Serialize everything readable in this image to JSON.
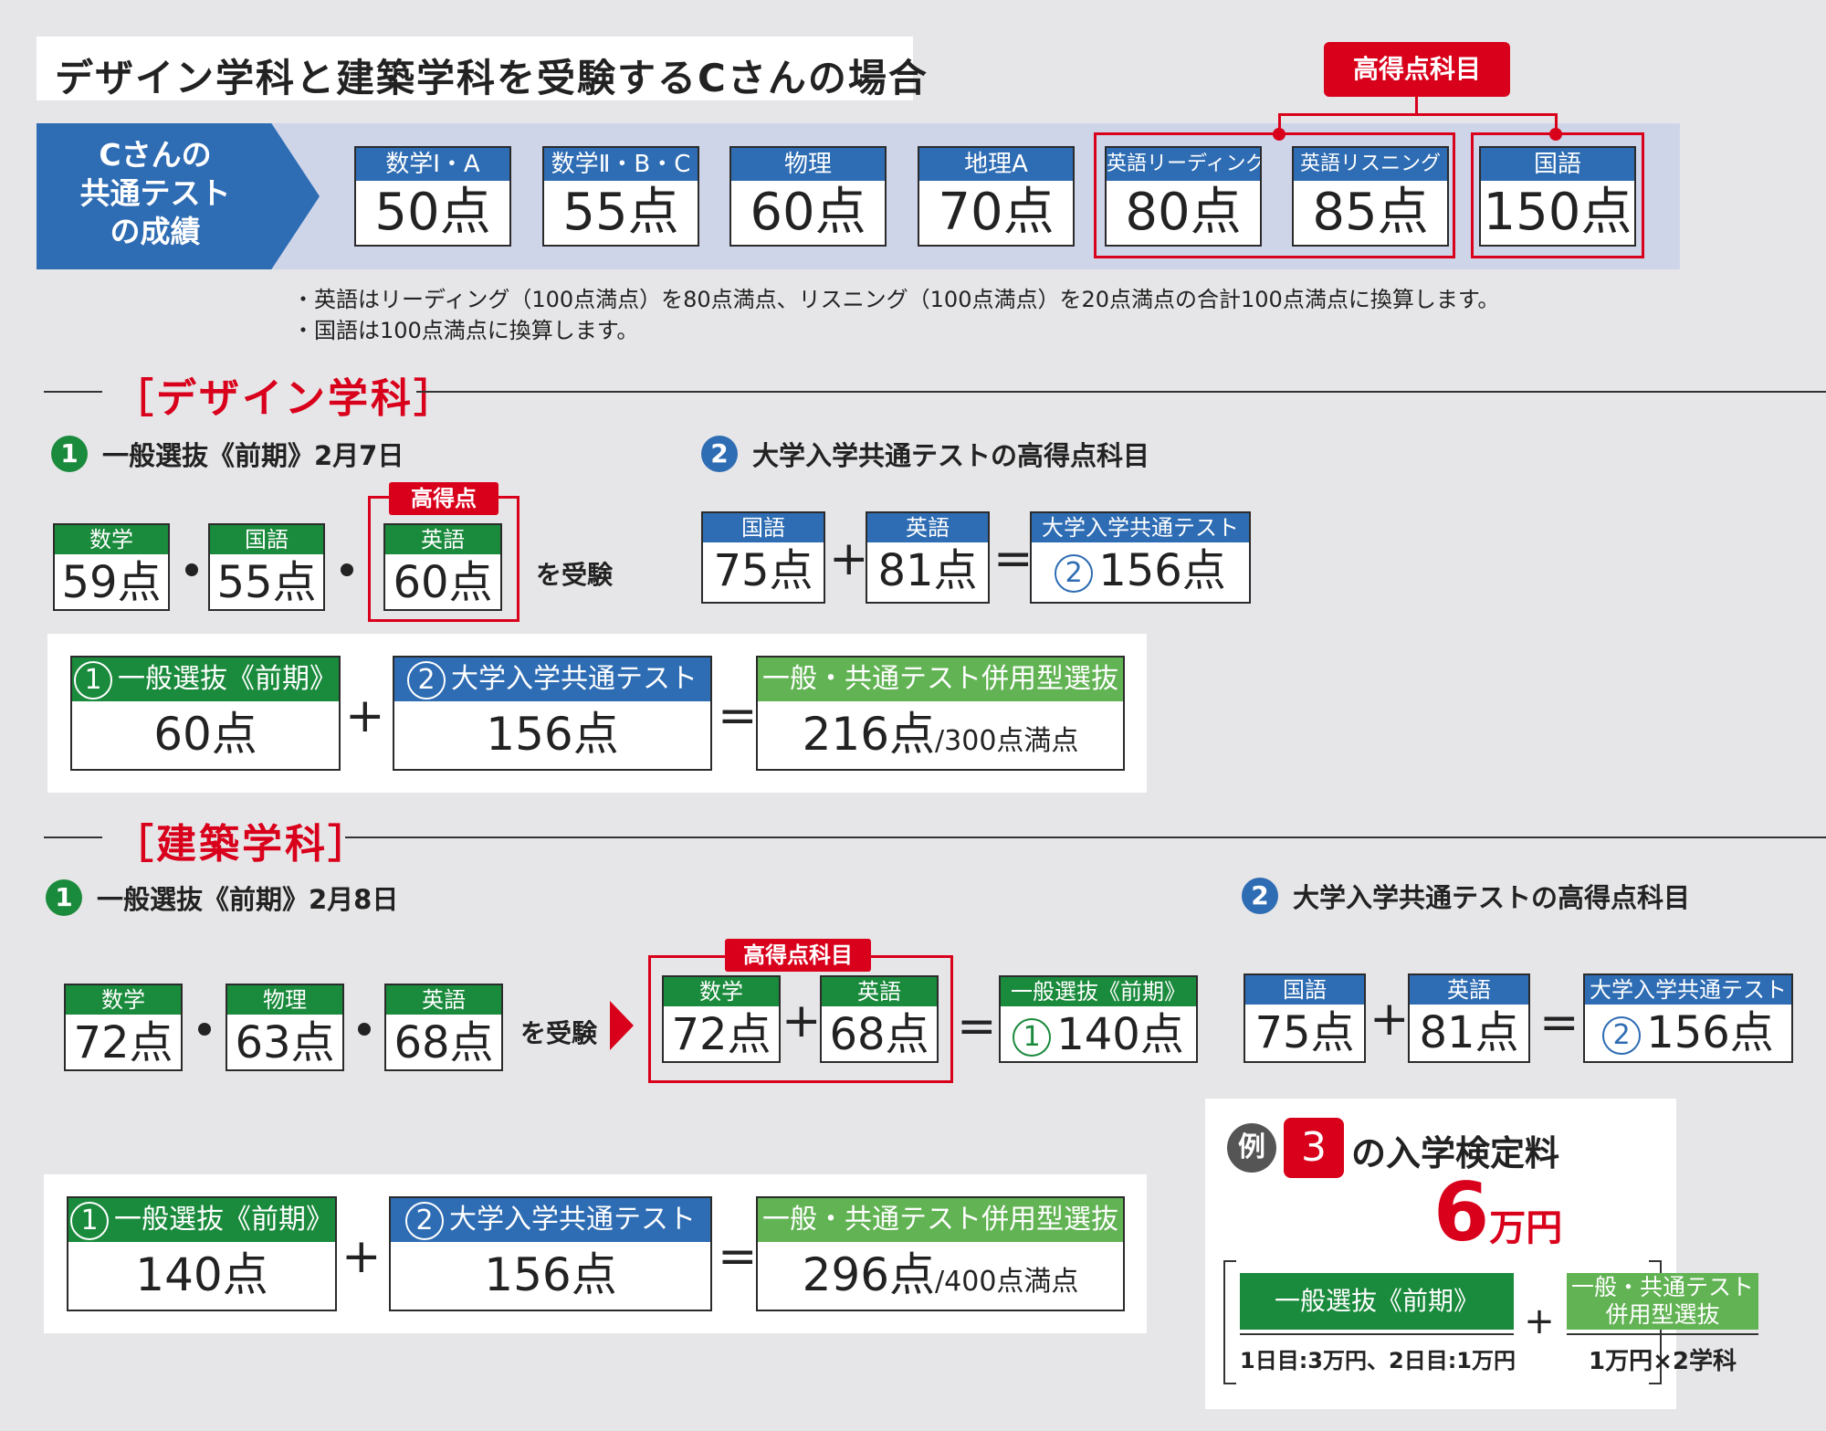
{
  "title": "デザイン学科と建築学科を受験するCさんの場合",
  "summary": {
    "label_lines": [
      "Cさんの",
      "共通テスト",
      "の成績"
    ],
    "high_tag": "高得点科目",
    "subjects": [
      {
        "name": "数学Ⅰ・A",
        "score": "50点"
      },
      {
        "name": "数学Ⅱ・B・C",
        "score": "55点"
      },
      {
        "name": "物理",
        "score": "60点"
      },
      {
        "name": "地理A",
        "score": "70点"
      },
      {
        "name": "英語リーディング",
        "score": "80点"
      },
      {
        "name": "英語リスニング",
        "score": "85点"
      },
      {
        "name": "国語",
        "score": "150点"
      }
    ],
    "notes": [
      "・英語はリーディング（100点満点）を80点満点、リスニング（100点満点）を20点満点の合計100点満点に換算します。",
      "・国語は100点満点に換算します。"
    ]
  },
  "design": {
    "section_title": "［デザイン学科］",
    "step1": {
      "num": "1",
      "label": "一般選抜《前期》2月7日"
    },
    "step2": {
      "num": "2",
      "label": "大学入学共通テストの高得点科目"
    },
    "exam": [
      {
        "name": "数学",
        "score": "59点"
      },
      {
        "name": "国語",
        "score": "55点"
      },
      {
        "name": "英語",
        "score": "60点"
      }
    ],
    "high_tag": "高得点",
    "juken": "を受験",
    "test": [
      {
        "name": "国語",
        "score": "75点"
      },
      {
        "name": "英語",
        "score": "81点"
      }
    ],
    "test_total": {
      "name": "大学入学共通テスト",
      "num": "2",
      "score": "156点"
    },
    "formula": {
      "a_label": "一般選抜《前期》",
      "a_num": "1",
      "a_val": "60点",
      "b_label": "大学入学共通テスト",
      "b_num": "2",
      "b_val": "156点",
      "c_label": "一般・共通テスト併用型選抜",
      "c_val": "216点",
      "c_suffix": "/300点満点"
    }
  },
  "arch": {
    "section_title": "［建築学科］",
    "step1": {
      "num": "1",
      "label": "一般選抜《前期》2月8日"
    },
    "step2": {
      "num": "2",
      "label": "大学入学共通テストの高得点科目"
    },
    "exam": [
      {
        "name": "数学",
        "score": "72点"
      },
      {
        "name": "物理",
        "score": "63点"
      },
      {
        "name": "英語",
        "score": "68点"
      }
    ],
    "juken": "を受験",
    "high_tag": "高得点科目",
    "high": [
      {
        "name": "数学",
        "score": "72点"
      },
      {
        "name": "英語",
        "score": "68点"
      }
    ],
    "high_total": {
      "name": "一般選抜《前期》",
      "num": "1",
      "score": "140点"
    },
    "test": [
      {
        "name": "国語",
        "score": "75点"
      },
      {
        "name": "英語",
        "score": "81点"
      }
    ],
    "test_total": {
      "name": "大学入学共通テスト",
      "num": "2",
      "score": "156点"
    },
    "formula": {
      "a_label": "一般選抜《前期》",
      "a_num": "1",
      "a_val": "140点",
      "b_label": "大学入学共通テスト",
      "b_num": "2",
      "b_val": "156点",
      "c_label": "一般・共通テスト併用型選抜",
      "c_val": "296点",
      "c_suffix": "/400点満点"
    }
  },
  "fee": {
    "rei": "例",
    "num": "3",
    "title": "の入学検定料",
    "amount": "6",
    "unit": "万円",
    "left_label": "一般選抜《前期》",
    "left_detail": "1日目:3万円、2日目:1万円",
    "right_label_1": "一般・共通テスト",
    "right_label_2": "併用型選抜",
    "right_detail": "1万円×2学科"
  },
  "symbols": {
    "plus": "+",
    "eq": "="
  },
  "colors": {
    "blue": "#2e6cb3",
    "green": "#1a8a3c",
    "light_green": "#62b354",
    "red": "#d9001b",
    "band": "#cfd5e9"
  }
}
